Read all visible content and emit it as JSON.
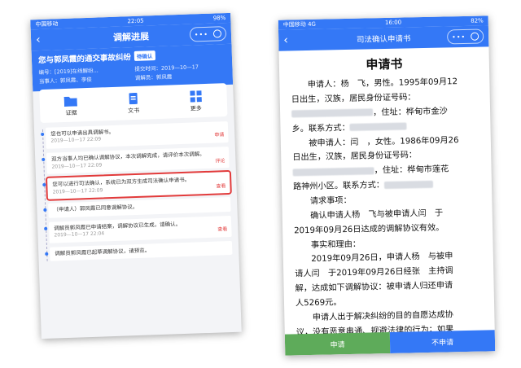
{
  "left_phone": {
    "status": {
      "carrier": "中国移动",
      "wifi": "",
      "time": "22:05",
      "battery": "98%"
    },
    "nav": {
      "back": "‹",
      "title": "调解进展"
    },
    "case": {
      "title": "您与郭凤霞的通交事故纠纷",
      "badge": "待确认",
      "meta": [
        "编号：[2019]在线解纷...",
        "提交时间：2019—10—17",
        "当事人：郭凤霞、李俊",
        "调解员：郭凤霞"
      ]
    },
    "cards": [
      {
        "label": "证据",
        "icon": "folder-icon"
      },
      {
        "label": "文书",
        "icon": "document-icon"
      },
      {
        "label": "更多",
        "icon": "grid-icon"
      }
    ],
    "events": [
      {
        "text": "您也可以申请出具调解书。",
        "time": "2019—10—17 22:09",
        "action": "申请"
      },
      {
        "text": "双方当事人均已确认调解协议，本次调解完成，请评价本次调解。",
        "time": "2019—10—17 22:09",
        "action": "评论"
      },
      {
        "text": "您可以进行司法确认，系统已为双方生成司法确认申请书。",
        "time": "2019—10—17 22:09",
        "action": "查看"
      },
      {
        "text": "（申请人）郭凤霞已同意调解协议。",
        "time": "",
        "action": ""
      },
      {
        "text": "调解员郭凤霞已申请结案，调解协议已生成，请确认。",
        "time": "2019—10—17 22:04",
        "action": "查看"
      },
      {
        "text": "调解员郭凤霞已起草调解协议，请预览。",
        "time": "",
        "action": ""
      }
    ]
  },
  "right_phone": {
    "status": {
      "carrier": "中国移动 4G",
      "time": "16:00",
      "battery": "82%"
    },
    "nav": {
      "back": "‹",
      "title": "司法确认申请书"
    },
    "doc": {
      "title": "申请书",
      "lines": [
        "申请人：杨　飞，男性。1995年09月12",
        "日出生，汉族，居民身份证号码：",
        "，住址：桦甸市金沙",
        "乡。联系方式：",
        "被申请人：闫　，女性。1986年09月26",
        "日出生，汉族，居民身份证号码：",
        "，住址：桦甸市莲花",
        "路神州小区。联系方式：",
        "请求事项：",
        "确认申请人杨　飞与被申请人闫　于",
        "2019年09月26日达成的调解协议有效。",
        "事实和理由：",
        "2019年09月26日，申请人杨　与被申",
        "请人闫　于2019年09月26日经张　主持调",
        "解，达成如下调解协议：被申请人归还申请",
        "人5269元。",
        "申请人出于解决纠纷的目的自愿达成协",
        "议，没有恶意串通、规避法律的行为；如果"
      ]
    },
    "buttons": {
      "apply": "申请",
      "decline": "不申请"
    }
  },
  "colors": {
    "accent": "#3478f6",
    "highlight": "#e23b3b",
    "apply": "#5eab5a"
  }
}
